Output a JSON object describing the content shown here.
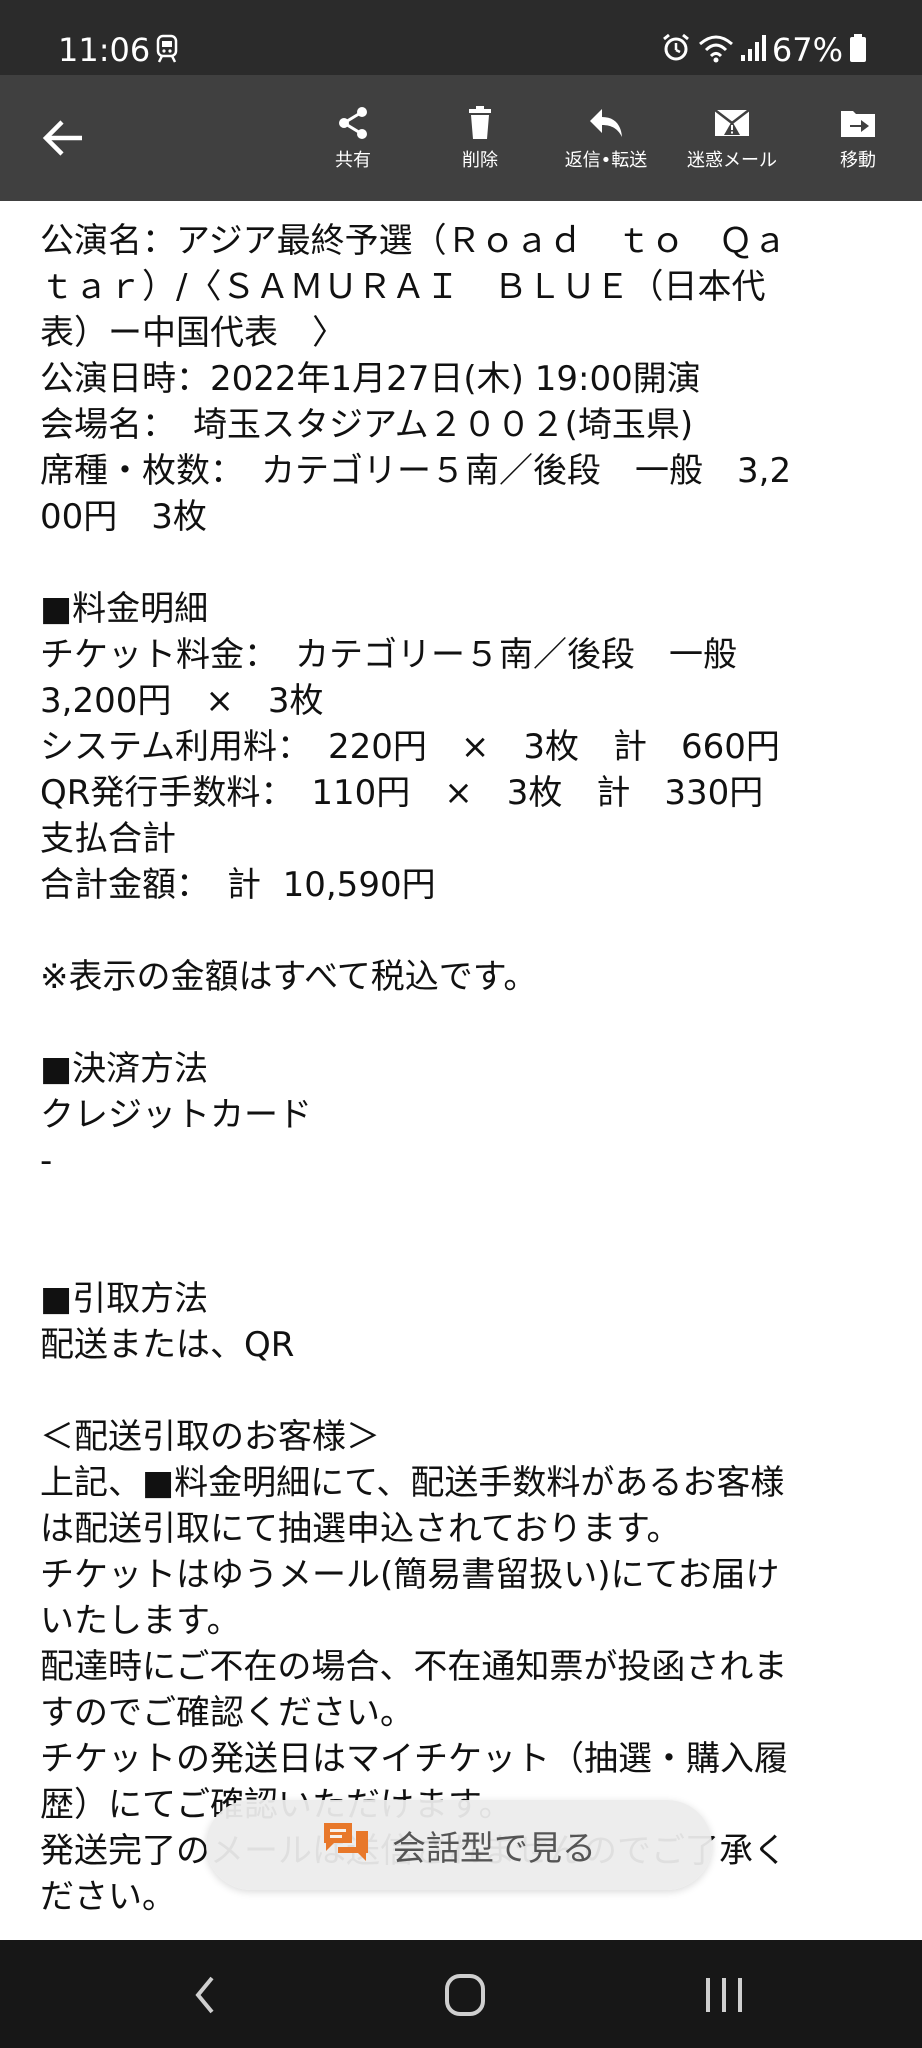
{
  "status_bar": {
    "time": "11:06",
    "battery": "67%",
    "icons": [
      "train-icon",
      "alarm-icon",
      "wifi-icon",
      "signal-icon",
      "battery-icon"
    ]
  },
  "toolbar": {
    "back_icon": "arrow-left-icon",
    "actions": [
      {
        "label": "共有",
        "icon": "share-icon"
      },
      {
        "label": "削除",
        "icon": "trash-icon"
      },
      {
        "label": "返信•転送",
        "icon": "reply-icon"
      },
      {
        "label": "迷惑メール",
        "icon": "spam-mail-icon"
      },
      {
        "label": "移動",
        "icon": "move-folder-icon"
      }
    ]
  },
  "message": {
    "lines": [
      "公演名：アジア最終予選（Ｒｏａｄ　ｔｏ　Ｑａ",
      "ｔａｒ）/〈ＳＡＭＵＲＡＩ　ＢＬＵＥ（日本代",
      "表）ー中国代表　〉",
      "公演日時：2022年1月27日(木) 19:00開演",
      "会場名：　埼玉スタジアム２００２(埼玉県)",
      "席種・枚数：　カテゴリー５南／後段　一般　3,2",
      "00円　3枚",
      "",
      "■料金明細",
      "チケット料金：　カテゴリー５南／後段　一般",
      "3,200円　×　3枚",
      "システム利用料：　220円　×　3枚　計　660円",
      "QR発行手数料：　110円　×　3枚　計　330円",
      "支払合計",
      "合計金額：　計  10,590円",
      "",
      "※表示の金額はすべて税込です。",
      "",
      "■決済方法",
      "クレジットカード",
      "-",
      "",
      "",
      "■引取方法",
      "配送または、QR",
      "",
      "＜配送引取のお客様＞",
      "上記、■料金明細にて、配送手数料があるお客様",
      "は配送引取にて抽選申込されております。",
      "チケットはゆうメール(簡易書留扱い)にてお届け",
      "いたします。",
      "配達時にご不在の場合、不在通知票が投函されま",
      "すのでご確認ください。",
      "チケットの発送日はマイチケット（抽選・購入履",
      "歴）にてご確認いただけます。",
      "発送完了のメールは送信されませんのでご了承く",
      "ださい。"
    ]
  },
  "fab": {
    "label": "会話型で見る",
    "icon": "chat-icon",
    "icon_color": "#e8782a"
  },
  "nav_bar": {
    "buttons": [
      "back-nav-icon",
      "home-nav-icon",
      "recents-nav-icon"
    ]
  },
  "colors": {
    "status_bar_bg": "#2b2b2b",
    "toolbar_bg": "#404040",
    "nav_bar_bg": "#171717"
  }
}
